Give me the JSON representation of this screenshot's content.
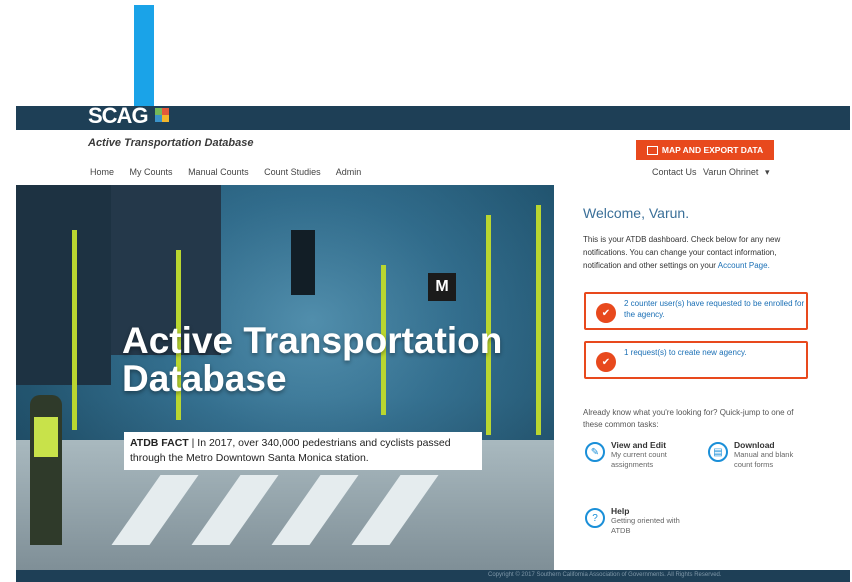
{
  "brand": {
    "logo_text": "SCAG",
    "subtitle": "Active Transportation Database"
  },
  "nav": {
    "items": [
      "Home",
      "My Counts",
      "Manual Counts",
      "Count Studies",
      "Admin"
    ]
  },
  "header_actions": {
    "map_button": "MAP AND EXPORT DATA",
    "contact": "Contact Us",
    "user": "Varun Ohrinet"
  },
  "hero": {
    "title_line1": "Active Transportation",
    "title_line2": "Database",
    "fact_label": "ATDB FACT",
    "fact_text": "In 2017, over 340,000 pedestrians and cyclists passed through the Metro Downtown Santa Monica station.",
    "metro_sign": "M"
  },
  "panel": {
    "welcome": "Welcome, Varun.",
    "intro_text": "This is your ATDB dashboard. Check below for any new notifications. You can change your contact information, notification and other settings on your",
    "intro_link": "Account Page.",
    "notifications": [
      "2 counter user(s) have requested to be enrolled for the agency.",
      "1 request(s) to create new agency."
    ],
    "quick_intro": "Already know what you're looking for? Quick-jump to one of these common tasks:",
    "tasks": [
      {
        "title": "View and Edit",
        "desc": "My current count assignments"
      },
      {
        "title": "Download",
        "desc": "Manual and blank count forms"
      },
      {
        "title": "Help",
        "desc": "Getting oriented with ATDB"
      }
    ]
  },
  "footer": {
    "text": "Copyright © 2017 Southern California Association of Governments. All Rights Reserved."
  },
  "colors": {
    "accent": "#e8491d",
    "link": "#1a6fb5",
    "header_bar": "#1e3f56",
    "annotation_arrow": "#1aa3e8"
  }
}
